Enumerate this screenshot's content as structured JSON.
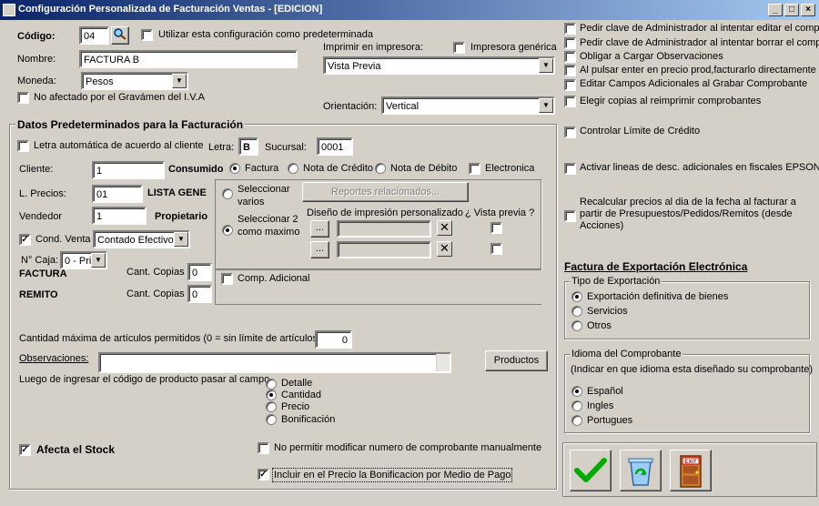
{
  "window": {
    "title": "Configuración Personalizada de Facturación Ventas - [EDICION]"
  },
  "top": {
    "codigo_label": "Código:",
    "codigo_value": "04",
    "predeterminada_label": "Utilizar esta configuración como predeterminada",
    "nombre_label": "Nombre:",
    "nombre_value": "FACTURA B",
    "moneda_label": "Moneda:",
    "moneda_value": "Pesos",
    "gravamen_label": "No afectado por el Gravámen del I.V.A",
    "imprimir_label": "Imprimir en impresora:",
    "impresora_generica_label": "Impresora genérica",
    "impresora_value": "Vista Previa",
    "orientacion_label": "Orientación:",
    "orientacion_value": "Vertical"
  },
  "datos": {
    "title": "Datos Predeterminados para la Facturación",
    "letra_auto_label": "Letra automática de acuerdo al cliente",
    "letra_label": "Letra:",
    "letra_value": "B",
    "sucursal_label": "Sucursal:",
    "sucursal_value": "0001",
    "cliente_label": "Cliente:",
    "cliente_value": "1",
    "cliente_name": "Consumido",
    "precios_label": "L. Precios:",
    "precios_value": "01",
    "precios_name": "LISTA GENE",
    "vendedor_label": "Vendedor",
    "vendedor_value": "1",
    "vendedor_name": "Propietario",
    "cond_venta_label": "Cond. Venta",
    "cond_venta_value": "Contado Efectivo",
    "caja_label": "N° Caja:",
    "caja_value": "0 - Prir",
    "factura_label": "FACTURA",
    "remito_label": "REMITO",
    "copias_label_1": "Cant. Copias",
    "copias_value_1": "0",
    "copias_label_2": "Cant. Copias",
    "copias_value_2": "0",
    "tipo_factura": "Factura",
    "tipo_nc": "Nota de Crédito",
    "tipo_nd": "Nota de Débito",
    "electronica": "Electronica",
    "sel_varios": "Seleccionar varios",
    "sel_dos": "Seleccionar 2 como maximo",
    "reportes_btn": "Reportes relacionados...",
    "diseno_label": "Diseño de impresión personalizado",
    "vista_previa_label": "¿ Vista previa ?",
    "browse_1": "...",
    "browse_2": "...",
    "comp_adicional": "Comp. Adicional",
    "cant_max_label": "Cantidad máxima de artículos permitidos (0 = sin límite de artículos)",
    "cant_max_value": "0",
    "observaciones_label": "Observaciones:",
    "productos_btn": "Productos",
    "luego_label": "Luego de ingresar el código de producto pasar al campo",
    "campo_detalle": "Detalle",
    "campo_cantidad": "Cantidad",
    "campo_precio": "Precio",
    "campo_bonificacion": "Bonificación",
    "afecta_stock": "Afecta el Stock",
    "no_permitir": "No permitir modificar numero de comprobante manualmente",
    "incluir": "Incluir en el Precio la Bonificacion por Medio de Pago"
  },
  "right": {
    "opt1": "Pedir clave de Administrador al intentar editar el comp.",
    "opt2": "Pedir clave de Administrador al intentar borrar el comp.",
    "opt3": "Obligar a Cargar Observaciones",
    "opt4": "Al pulsar enter en precio prod,facturarlo directamente",
    "opt5": "Editar Campos Adicionales al Grabar Comprobante",
    "opt6": "Elegir copias al reimprimir comprobantes",
    "opt7": "Controlar Límite de Crédito",
    "opt8": "Activar lineas de desc. adicionales en fiscales EPSON",
    "opt9": "Recalcular precios al dia de la fecha al facturar a partir de Presupuestos/Pedidos/Remitos (desde Acciones)",
    "export_title": "Factura de Exportación Electrónica",
    "tipo_exp_title": "Tipo de Exportación",
    "exp_bienes": "Exportación definitiva de bienes",
    "exp_servicios": "Servicios",
    "exp_otros": "Otros",
    "idioma_title": "Idioma del Comprobante",
    "idioma_hint": "(Indicar en que idioma esta diseñado su comprobante)",
    "idioma_es": "Español",
    "idioma_en": "Ingles",
    "idioma_pt": "Portugues",
    "exit_label": "EXIT"
  }
}
